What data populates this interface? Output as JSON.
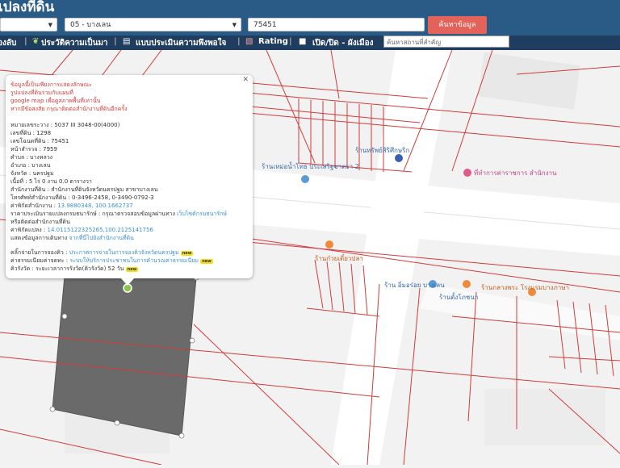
{
  "header": {
    "title": "เปลงที่ดิน"
  },
  "search": {
    "province_value": "",
    "district_value": "05 - บางเลน",
    "parcel_value": "75451",
    "search_button": "ค้นหาข้อมูล"
  },
  "toolbar": {
    "item1": "องลับ",
    "item2": "ประวัติความเป็นมา",
    "item3": "แบบประเมินความพึงพอใจ",
    "item4": "Rating",
    "item5": "เปิด/ปิด - ผังเมือง",
    "place_search_placeholder": "ค้นหาสถานที่สำคัญ"
  },
  "popup": {
    "notice": [
      "ข้อมูลนี้เป็นเพียงการแสดงลักษณะ",
      "รูปแปลงที่ดินร่วมกับแผนที่",
      "google map เพื่อดูสภาพพื้นที่เท่านั้น",
      "หากมีข้อสงสัย กรุณาติดต่อสำนักงานที่ดินอีกครั้ง"
    ],
    "fields": [
      {
        "label": "หมายเลขระวาง",
        "value": "5037 III 3048-00(4000)"
      },
      {
        "label": "เลขที่ดิน",
        "value": "1298"
      },
      {
        "label": "เลขโฉนดที่ดิน",
        "value": "75451"
      },
      {
        "label": "หน้าสำรวจ",
        "value": "7959"
      },
      {
        "label": "ตำบล",
        "value": "บางหลวง"
      },
      {
        "label": "อำเภอ",
        "value": "บางเลน"
      },
      {
        "label": "จังหวัด",
        "value": "นครปฐม"
      },
      {
        "label": "เนื้อที่",
        "value": "5 ไร่ 0 งาน 0.0 ตารางวา"
      },
      {
        "label": "สำนักงานที่ดิน",
        "value": "สำนักงานที่ดินจังหวัดนครปฐม สาขาบางเลน"
      },
      {
        "label": "โทรศัพท์สำนักงานที่ดิน",
        "value": "0-3496-2458, 0-3490-0792-3"
      },
      {
        "label": "ค่าพิกัดสำนักงาน",
        "value": "13.9880348, 100.1662737"
      }
    ],
    "price_label": "ราคาประเมินรายแปลงกรมธนารักษ์",
    "price_text": "กรุณาตรวจสอบข้อมูลผ่านทาง",
    "price_link": "เว็บไซต์กรมธนารักษ์",
    "price_line2": "หรือติดต่อสำนักงานที่ดิน",
    "coord_label": "ค่าพิกัดแปลง",
    "coord_value": "14.0115122325265,100.2125141756",
    "route_label": "แสดงข้อมูลการเดินทาง",
    "route_link": "จากที่นี่ไปยังสำนักงานที่ดิน",
    "queue_label": "คลิ๊กจ่ายในการจองคิว",
    "queue_link": "ประกาศการจ่ายในการจองคิวจังหวัดนครปฐม",
    "estate_label": "ค่าธรรมเนียมค่าจดทะ",
    "estate_link": "ระบบให้บริการประชาชนในการคำนวณค่าธรรมเนียม",
    "wait_label": "คิวรังวัด",
    "wait_text": "ระยะเวลาการรังวัด(คิวรังวัด) 52 วัน",
    "new_badge": "new"
  },
  "map_labels": {
    "shop1": "ร้านเหม่อน้ำโทธ ประเสริฐชาตรา 2",
    "shop2": "ร้านทรัพย์สิริศึกษริก",
    "shop3": "ที่ทำการค่าราชการ สำนักงาน",
    "shop4": "ร้านก๋วยเตี๋ยวปลา",
    "shop5": "ร้าน อิ่มอร่อย บางเลน",
    "shop6": "ร้านตั้งโภชนา",
    "shop7": "ร้านกลางพระ โรงแรมบางภาษา"
  }
}
